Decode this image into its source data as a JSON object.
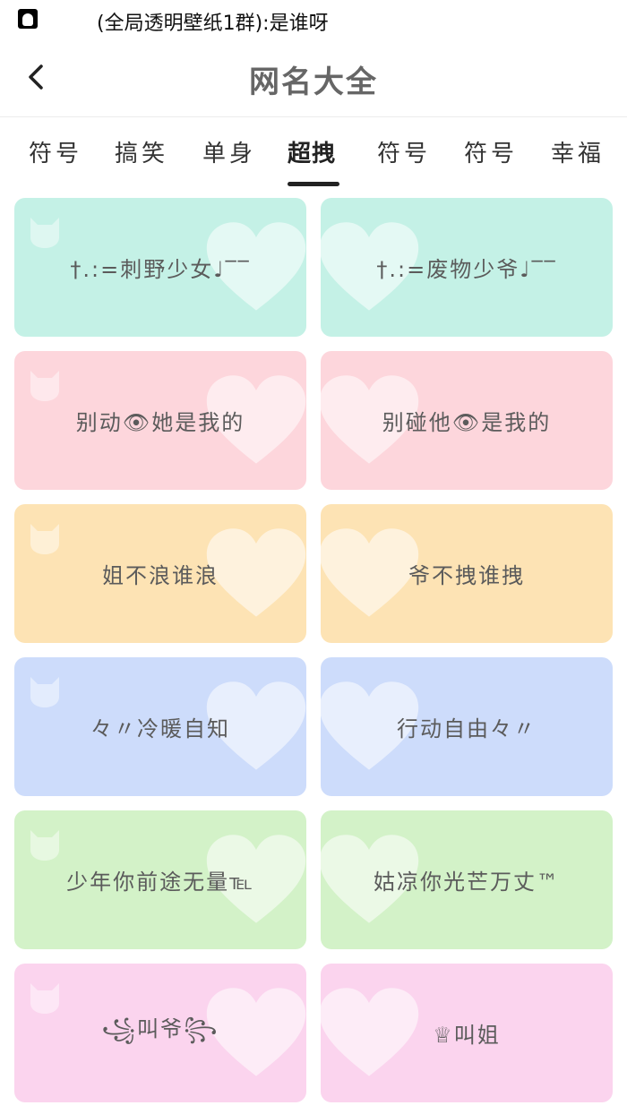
{
  "status_bar": {
    "app_icon": "qq-icon",
    "notification": "(全局透明壁纸1群):是谁呀"
  },
  "header": {
    "back_icon": "chevron-left-icon",
    "title": "网名大全"
  },
  "tabs": [
    {
      "label": "符号",
      "active": false
    },
    {
      "label": "搞笑",
      "active": false
    },
    {
      "label": "单身",
      "active": false
    },
    {
      "label": "超拽",
      "active": true
    },
    {
      "label": "符号",
      "active": false
    },
    {
      "label": "符号",
      "active": false
    },
    {
      "label": "幸福",
      "active": false
    }
  ],
  "cards": [
    {
      "text": "†.:=刺野少女♩‾‾",
      "color": "#c4f1e6"
    },
    {
      "text": "†.:=废物少爷♩‾‾",
      "color": "#c4f1e6"
    },
    {
      "text": "别动👁她是我的",
      "color": "#fdd6dc"
    },
    {
      "text": "别碰他👁是我的",
      "color": "#fdd6dc"
    },
    {
      "text": "姐不浪谁浪",
      "color": "#fde3b4"
    },
    {
      "text": "爷不拽谁拽",
      "color": "#fde3b4"
    },
    {
      "text": "々〃冷暖自知",
      "color": "#cddcfb"
    },
    {
      "text": "行动自由々〃",
      "color": "#cddcfb"
    },
    {
      "text": "少年你前途无量℡",
      "color": "#d3f2c8"
    },
    {
      "text": "姑凉你光芒万丈™",
      "color": "#d3f2c8"
    },
    {
      "text": "꧁叫爷꧂",
      "color": "#fbd4ee"
    },
    {
      "text": "♕叫姐",
      "color": "#fbd4ee"
    }
  ]
}
